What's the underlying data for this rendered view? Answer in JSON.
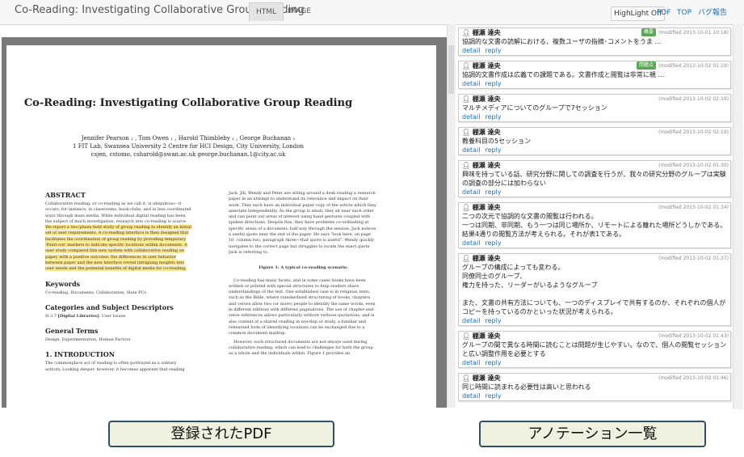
{
  "header": {
    "title": "Co-Reading: Investigating Collaborative Group Reading",
    "tabs": [
      "HTML",
      "IMAGE"
    ],
    "highlight_btn": "HighLight Off",
    "pdf_link": "PDF",
    "top_link": "TOP",
    "bug_link": "バグ報告"
  },
  "paper": {
    "title": "Co-Reading: Investigating Collaborative Group Reading",
    "authors": "Jennifer Pearson ₁ , Tom Owen ₁ , Harold Thimbleby ₁ , George Buchanan ₂",
    "affiliations": "1 FIT Lab, Swansea University 2 Centre for HCI Design, City University, London",
    "emails": "csjen, cstomo, csharold@swan.ac.uk george.buchanan.1@city.ac.uk",
    "abstract_heading": "ABSTRACT",
    "abstract_plain": "Collaborative reading, or co-reading as we call it, is ubiquitous—it occurs, for instance, in classrooms, book-clubs, and in less coordinated ways through mass media. While individual digital reading has been the subject of much investigation, research into co-reading is scarce. ",
    "abstract_highlight": "We report a two-phase field study of group reading to identify an initial set of user requirements. A co-reading interface is then designed that facilitates the coordination of group reading by providing temporary 'Point-out' markers to indicate specific locations within documents. A user study compared this new system with collaborative reading on paper, with a positive outcome; the differences in user behavior between paper and the new interface reveal intriguing insights into user needs and the potential benefits of digital media for co-reading.",
    "keywords_heading": "Keywords",
    "keywords": "Co-reading, Documents, Collaboration, Slate PCs",
    "categories_heading": "Categories and Subject Descriptors",
    "categories_prefix": "H.3.7 ",
    "categories_bold": "[Digital Libraries]",
    "categories_suffix": ": User Issues",
    "terms_heading": "General Terms",
    "terms": "Design, Experimentation, Human Factors",
    "intro_heading": "1. INTRODUCTION",
    "intro": "The commonplace act of reading is often portrayed as a solitary activity. Looking deeper, however, it becomes apparent that reading",
    "col2_para1": "Jack, Jill, Wendy and Peter are sitting around a desk reading a research paper in an attempt to understand its relevance and impact on their work. They each have an individual paper copy of the article which they annotate independently. As the group is small, they sit near each other and can point out areas of interest using hand gestures coupled with spoken directions. Despite this, they have problems co-ordinating at specific areas of a document: half way through the session, Jack notices a useful quote near the end of the paper. He says \"look here, on page 10, column two, paragraph three—that quote is useful\". Wendy quickly navigates to the correct page but struggles to locate the exact quote Jack is referring to.",
    "figure_caption": "Figure 1: A typical co-reading scenario.",
    "col2_para2": "Co-reading has many facets, and in some cases books have been written or printed with special structures to help readers share understandings of the text. One established case is in religious texts, such as the Bible, where standardized structuring of books, chapters and verses allow two (or more) people to identify the same words, even in different editions with different paginations. The use of chapter-and-verse references allows particularly without verbose quotations, and is also context of a shared reading in worship or study, a familiar and rehearsed form of identifying locations can be exchanged due to a common document markup.",
    "col2_para3": "However, such structured documents are not always used during collaborative reading, which can lead to challenges for both the group as a whole and the individuals within. Figure 1 provides an"
  },
  "annotations": [
    {
      "author": "棚瀬 達央",
      "date": "(modified 2013-10-01 10:18)",
      "badge": "概要",
      "text": "協調的な文書の読解における、複数ユーザの指摘･コメントをうま …",
      "detail": "detail",
      "reply": "reply"
    },
    {
      "author": "棚瀬 達央",
      "date": "(modified 2013-10-02 01:19)",
      "badge": "問題点",
      "text": "協調的文書作成は広義での課題である。文書作成と閲覧は非常に親 …",
      "detail": "detail",
      "reply": "reply"
    },
    {
      "author": "棚瀬 達央",
      "date": "(modified 2013-10-02 02:19)",
      "badge": "",
      "text": "マルチメディアについてのグループで7セッション",
      "detail": "detail",
      "reply": "reply"
    },
    {
      "author": "棚瀬 達央",
      "date": "(modified 2013-10-02 02:19)",
      "badge": "",
      "text": "教養科目の5セッション",
      "detail": "detail",
      "reply": "reply"
    },
    {
      "author": "棚瀬 達央",
      "date": "(modified 2013-10-02 01:30)",
      "badge": "",
      "text": "興味を持っている話、研究分野に関しての調査を行うが、我々の研究分野のグループは実験の調査の部分には加わらない",
      "detail": "detail",
      "reply": "reply"
    },
    {
      "author": "棚瀬 達央",
      "date": "(modified 2013-10-02 01:34)",
      "badge": "",
      "text": "二つの次元で協調的な文書の閲覧は行われる。\n一つは同期、非同期、もう一つは同じ場所か、リモートによる離れた場所どうしかである。結果4通りの閲覧方法が考えられる。それが表1である。",
      "detail": "detail",
      "reply": "reply"
    },
    {
      "author": "棚瀬 達央",
      "date": "(modified 2013-10-02 01:37)",
      "badge": "",
      "text": "グループの構成によっても変わる。\n同僚同士のグループ、\n権力を持った、リーダーがいるようなグループ\n\nまた、文書の共有方法についても、一つのディスプレイで共有するのか、それぞれの個人がコピーを持っているのかといった状況が考えられる。",
      "detail": "detail",
      "reply": "reply"
    },
    {
      "author": "棚瀬 達央",
      "date": "(modified 2013-10-02 01:43)",
      "badge": "",
      "text": "グループの間で異なる時間に読むことは問題が生じやすい。なので、個人の閲覧セッションと広い調整作用を必要とする",
      "detail": "detail",
      "reply": "reply"
    },
    {
      "author": "棚瀬 達央",
      "date": "(modified 2013-10-02 01:46)",
      "badge": "",
      "text": "同じ時間に読まれる必要性は高いと思われる",
      "detail": "detail",
      "reply": "reply"
    }
  ],
  "captions": {
    "left": "登録されたPDF",
    "right": "アノテーション一覧"
  }
}
